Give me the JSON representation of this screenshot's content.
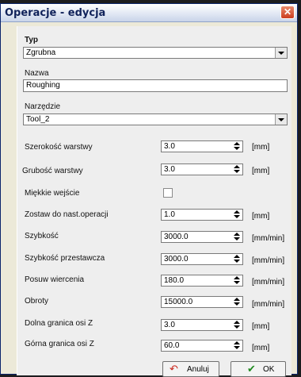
{
  "window": {
    "title": "Operacje - edycja"
  },
  "typ": {
    "label": "Typ",
    "value": "Zgrubna"
  },
  "nazwa": {
    "label": "Nazwa",
    "value": "Roughing"
  },
  "narzedzie": {
    "label": "Narzędzie",
    "value": "Tool_2"
  },
  "fields": {
    "szerokosc": {
      "label": "Szerokość warstwy",
      "value": "3.0",
      "unit": "[mm]"
    },
    "grubosc": {
      "label": "Grubość warstwy",
      "value": "3.0",
      "unit": "[mm]"
    },
    "miekkie": {
      "label": "Miękkie wejście",
      "checked": false
    },
    "zostaw": {
      "label": "Zostaw do nast.operacji",
      "value": "1.0",
      "unit": "[mm]"
    },
    "szybkosc": {
      "label": "Szybkość",
      "value": "3000.0",
      "unit": "[mm/min]"
    },
    "przestawcza": {
      "label": "Szybkość przestawcza",
      "value": "3000.0",
      "unit": "[mm/min]"
    },
    "posuw": {
      "label": "Posuw wiercenia",
      "value": "180.0",
      "unit": "[mm/min]"
    },
    "obroty": {
      "label": "Obroty",
      "value": "15000.0",
      "unit": "[mm/min]"
    },
    "dolna": {
      "label": "Dolna granica osi Z",
      "value": "3.0",
      "unit": "[mm]"
    },
    "gorna": {
      "label": "Górna granica osi Z",
      "value": "60.0",
      "unit": "[mm]"
    }
  },
  "buttons": {
    "cancel": "Anuluj",
    "ok": "OK"
  },
  "icons": {
    "close": "close-icon",
    "cancel": "undo-arrow-icon",
    "ok": "checkmark-icon"
  },
  "colors": {
    "titlebar_text": "#10225a",
    "close": "#cc3d1f",
    "cancel_icon": "#c8241a",
    "ok_icon": "#1f8a1f"
  }
}
